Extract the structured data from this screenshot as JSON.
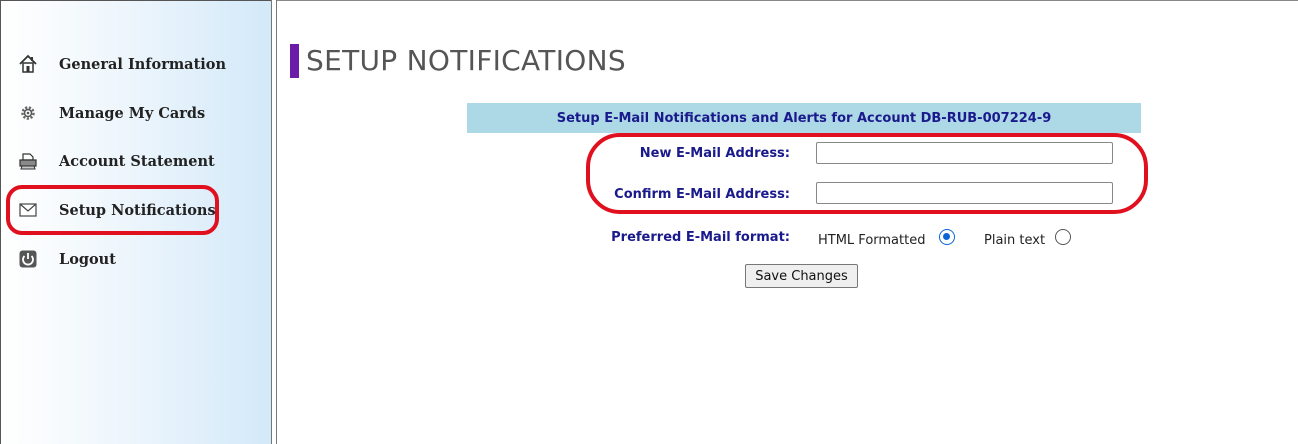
{
  "sidebar": {
    "items": [
      {
        "icon": "home-icon",
        "label": "General Information"
      },
      {
        "icon": "gear-icon",
        "label": "Manage My Cards"
      },
      {
        "icon": "printer-icon",
        "label": "Account Statement"
      },
      {
        "icon": "envelope-icon",
        "label": "Setup Notifications"
      },
      {
        "icon": "power-icon",
        "label": "Logout"
      }
    ]
  },
  "main": {
    "title": "SETUP NOTIFICATIONS",
    "title_accent_color": "#6a1ba8",
    "header": "Setup E-Mail Notifications and Alerts for Account DB-RUB-007224-9",
    "fields": {
      "new_email_label": "New E-Mail Address:",
      "new_email_value": "",
      "confirm_email_label": "Confirm E-Mail Address:",
      "confirm_email_value": ""
    },
    "format": {
      "label": "Preferred E-Mail format:",
      "options": [
        {
          "label": "HTML Formatted",
          "selected": true
        },
        {
          "label": "Plain text",
          "selected": false
        }
      ]
    },
    "save_label": "Save Changes"
  },
  "annotation_color": "#e0101e"
}
